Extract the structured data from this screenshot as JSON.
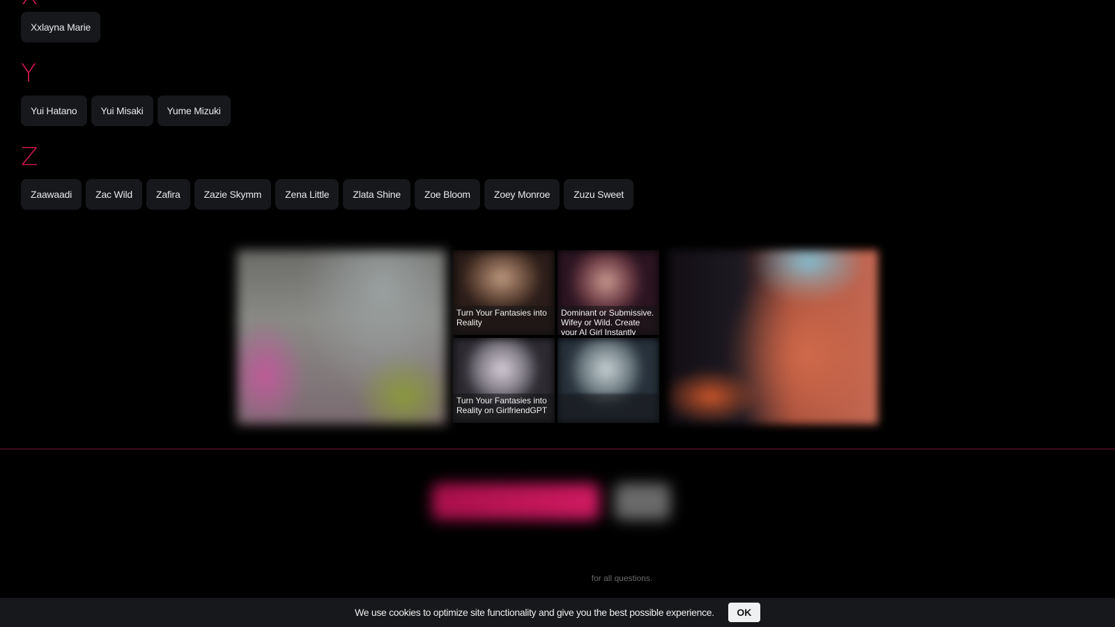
{
  "sections": [
    {
      "letter": "X",
      "names": [
        "Xxlayna Marie"
      ]
    },
    {
      "letter": "Y",
      "names": [
        "Yui Hatano",
        "Yui Misaki",
        "Yume Mizuki"
      ]
    },
    {
      "letter": "Z",
      "names": [
        "Zaawaadi",
        "Zac Wild",
        "Zafira",
        "Zazie Skymm",
        "Zena Little",
        "Zlata Shine",
        "Zoe Bloom",
        "Zoey Monroe",
        "Zuzu Sweet"
      ]
    }
  ],
  "promo": {
    "tiles": [
      {
        "caption": "Turn Your Fantasies into Reality"
      },
      {
        "caption": "Dominant or Submissive. Wifey or Wild. Create your AI Girl Instantly"
      },
      {
        "caption": "Turn Your Fantasies into Reality on GirlfriendGPT"
      },
      {
        "caption": ""
      }
    ]
  },
  "footer": {
    "note": "for all questions."
  },
  "cookie": {
    "text": "We use cookies to optimize site functionality and give you the best possible experience.",
    "ok_label": "OK"
  },
  "colors": {
    "accent": "#d1194f",
    "chip_bg": "#16181c",
    "background": "#000000",
    "divider": "#7a1531"
  }
}
